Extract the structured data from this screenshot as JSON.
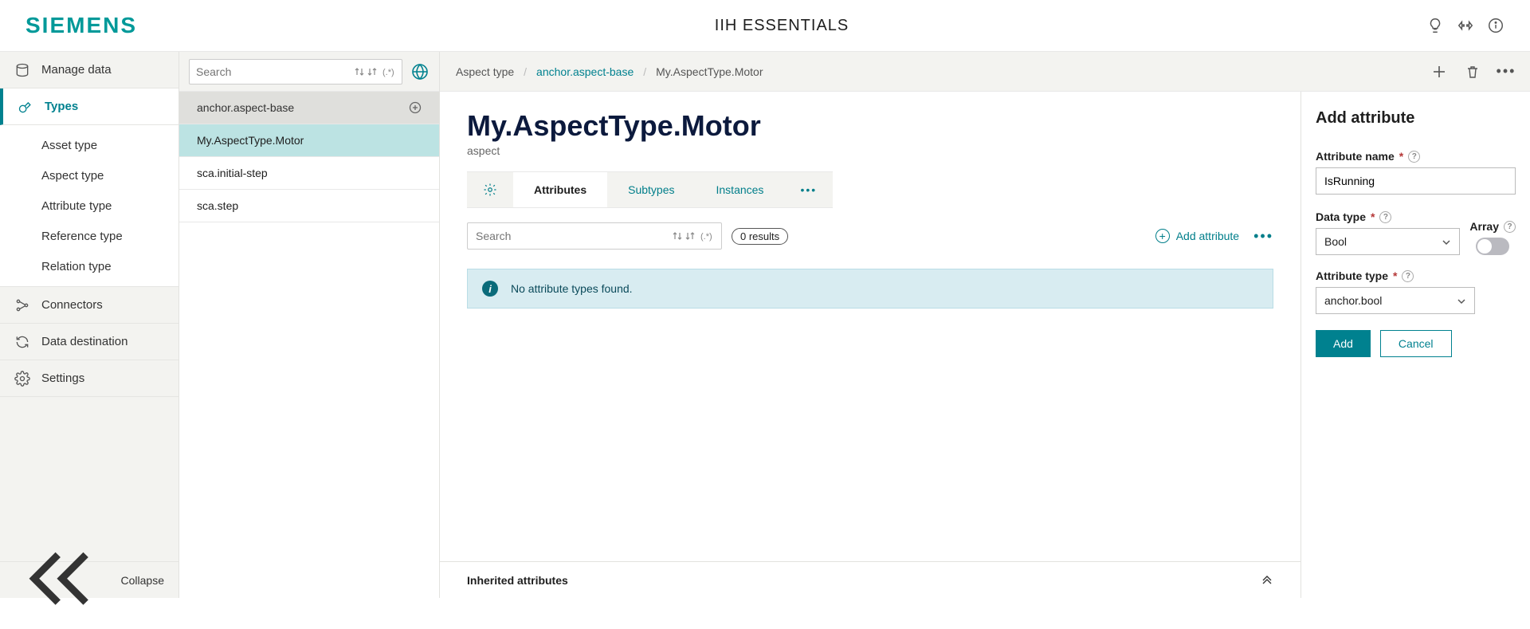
{
  "brand": "SIEMENS",
  "header_title": "IIH ESSENTIALS",
  "nav": {
    "manage": "Manage data",
    "types": "Types",
    "types_children": [
      "Asset type",
      "Aspect type",
      "Attribute type",
      "Reference type",
      "Relation type"
    ],
    "connectors": "Connectors",
    "destination": "Data destination",
    "settings": "Settings",
    "collapse": "Collapse"
  },
  "second": {
    "search_placeholder": "Search",
    "header_item": "anchor.aspect-base",
    "items": [
      "My.AspectType.Motor",
      "sca.initial-step",
      "sca.step"
    ],
    "selected_index": 0
  },
  "breadcrumb": {
    "a": "Aspect type",
    "b": "anchor.aspect-base",
    "c": "My.AspectType.Motor"
  },
  "page": {
    "title": "My.AspectType.Motor",
    "subtitle": "aspect"
  },
  "tabs": {
    "attributes": "Attributes",
    "subtypes": "Subtypes",
    "instances": "Instances"
  },
  "attr_search": {
    "placeholder": "Search",
    "results": "0 results",
    "add": "Add attribute",
    "banner": "No attribute types found."
  },
  "inherited": "Inherited attributes",
  "panel": {
    "title": "Add attribute",
    "name_label": "Attribute name",
    "name_value": "IsRunning",
    "datatype_label": "Data type",
    "datatype_value": "Bool",
    "array_label": "Array",
    "attrtype_label": "Attribute type",
    "attrtype_value": "anchor.bool",
    "add": "Add",
    "cancel": "Cancel"
  }
}
